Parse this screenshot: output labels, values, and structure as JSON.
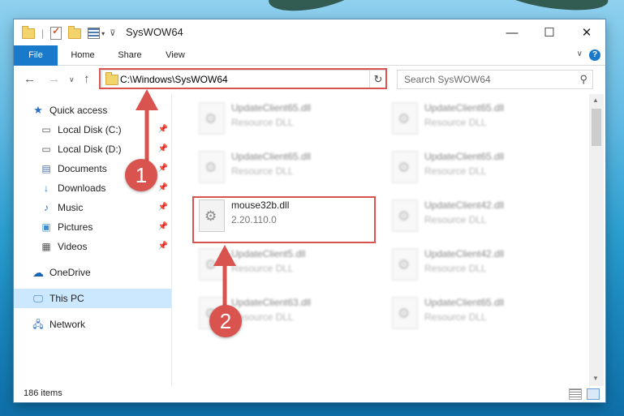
{
  "window": {
    "title": "SysWOW64",
    "controls": {
      "minimize": "—",
      "maximize": "☐",
      "close": "✕"
    }
  },
  "ribbon": {
    "tabs": [
      "File",
      "Home",
      "Share",
      "View"
    ],
    "help": "?"
  },
  "navigation": {
    "address": "C:\\Windows\\SysWOW64",
    "search_placeholder": "Search SysWOW64"
  },
  "sidebar": {
    "quick_access": "Quick access",
    "items": [
      {
        "label": "Local Disk (C:)",
        "icon": "drive-icon"
      },
      {
        "label": "Local Disk (D:)",
        "icon": "drive-icon"
      },
      {
        "label": "Documents",
        "icon": "documents-icon"
      },
      {
        "label": "Downloads",
        "icon": "downloads-icon"
      },
      {
        "label": "Music",
        "icon": "music-icon"
      },
      {
        "label": "Pictures",
        "icon": "pictures-icon"
      },
      {
        "label": "Videos",
        "icon": "videos-icon"
      }
    ],
    "onedrive": "OneDrive",
    "this_pc": "This PC",
    "network": "Network"
  },
  "files": [
    {
      "name": "UpdateClient65.dll",
      "desc": "Resource DLL"
    },
    {
      "name": "UpdateClient65.dll",
      "desc": "Resource DLL"
    },
    {
      "name": "UpdateClient65.dll",
      "desc": "Resource DLL"
    },
    {
      "name": "UpdateClient65.dll",
      "desc": "Resource DLL"
    },
    {
      "name": "mouse32b.dll",
      "desc": "2.20.110.0"
    },
    {
      "name": "UpdateClient42.dll",
      "desc": "Resource DLL"
    },
    {
      "name": "UpdateClient5.dll",
      "desc": "Resource DLL"
    },
    {
      "name": "UpdateClient42.dll",
      "desc": "Resource DLL"
    },
    {
      "name": "UpdateClient63.dll",
      "desc": "Resource DLL"
    },
    {
      "name": "UpdateClient65.dll",
      "desc": "Resource DLL"
    }
  ],
  "status": {
    "item_count": "186 items"
  },
  "annotations": {
    "step1": "1",
    "step2": "2"
  },
  "colors": {
    "accent": "#1979ca",
    "highlight": "#d9534f",
    "selected": "#cce8ff"
  }
}
